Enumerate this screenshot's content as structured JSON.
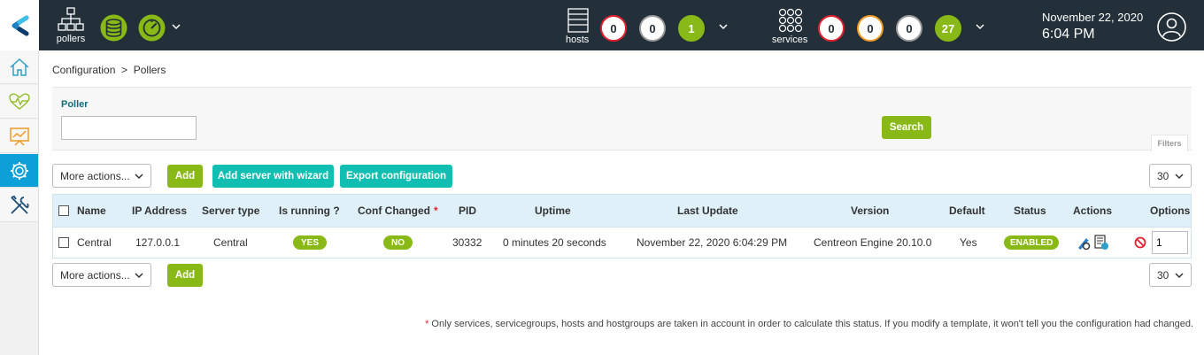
{
  "topbar": {
    "pollers_label": "pollers",
    "hosts_label": "hosts",
    "services_label": "services",
    "hosts_counts": [
      "0",
      "0",
      "1"
    ],
    "services_counts": [
      "0",
      "0",
      "0",
      "27"
    ],
    "date": "November 22, 2020",
    "time": "6:04 PM"
  },
  "sidebar": {
    "items": [
      "home-icon",
      "monitoring-icon",
      "reporting-icon",
      "configuration-icon",
      "administration-icon"
    ]
  },
  "breadcrumb": "Configuration  >  Pollers",
  "filters": {
    "poller_label": "Poller",
    "poller_value": "",
    "search_label": "Search",
    "filters_tab": "Filters"
  },
  "toolbar": {
    "more_actions": "More actions...",
    "add": "Add",
    "add_wizard": "Add server with wizard",
    "export": "Export configuration",
    "page_size": "30"
  },
  "table": {
    "headers": {
      "name": "Name",
      "ip": "IP Address",
      "server_type": "Server type",
      "is_running": "Is running ?",
      "conf_changed": "Conf Changed",
      "conf_changed_star": "*",
      "pid": "PID",
      "uptime": "Uptime",
      "last_update": "Last Update",
      "version": "Version",
      "default": "Default",
      "status": "Status",
      "actions": "Actions",
      "options": "Options"
    },
    "rows": [
      {
        "name": "Central",
        "ip": "127.0.0.1",
        "server_type": "Central",
        "is_running": "YES",
        "conf_changed": "NO",
        "pid": "30332",
        "uptime": "0 minutes 20 seconds",
        "last_update": "November 22, 2020 6:04:29 PM",
        "version": "Centreon Engine 20.10.0",
        "default": "Yes",
        "status": "ENABLED",
        "options_value": "1"
      }
    ]
  },
  "footnote": {
    "star": "*",
    "text": "Only services, servicegroups, hosts and hostgroups are taken in account in order to calculate this status. If you modify a template, it won't tell you the configuration had changed."
  },
  "colors": {
    "topbar": "#232f39",
    "accent_green": "#88b917",
    "accent_teal": "#10bfb1",
    "active_blue": "#0d9fd8",
    "critical": "#e0202e",
    "warning": "#ee9a24"
  }
}
